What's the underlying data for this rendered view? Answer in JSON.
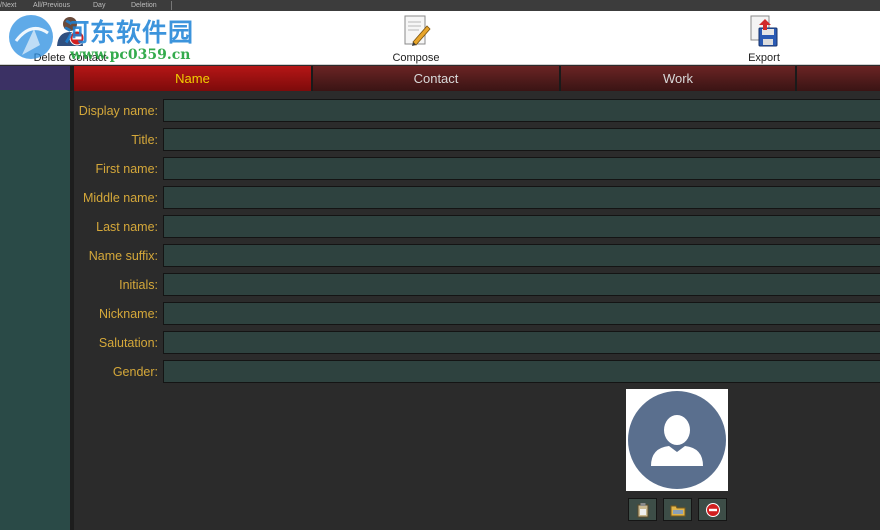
{
  "topbar": {
    "items": [
      "/Next",
      "All/Previous",
      "Day",
      "Deletion"
    ]
  },
  "toolbar": {
    "delete_contact_label": "Delete Contact",
    "compose_label": "Compose",
    "export_label": "Export"
  },
  "watermark": {
    "text": "河东软件园",
    "url": "www.pc0359.cn"
  },
  "tabs": [
    {
      "label": "Name",
      "active": true
    },
    {
      "label": "Contact",
      "active": false
    },
    {
      "label": "Work",
      "active": false
    },
    {
      "label": "",
      "active": false
    }
  ],
  "form": {
    "fields": [
      {
        "label": "Display name:",
        "value": ""
      },
      {
        "label": "Title:",
        "value": ""
      },
      {
        "label": "First name:",
        "value": ""
      },
      {
        "label": "Middle name:",
        "value": ""
      },
      {
        "label": "Last name:",
        "value": ""
      },
      {
        "label": "Name suffix:",
        "value": ""
      },
      {
        "label": "Initials:",
        "value": ""
      },
      {
        "label": "Nickname:",
        "value": ""
      },
      {
        "label": "Salutation:",
        "value": ""
      },
      {
        "label": "Gender:",
        "value": ""
      }
    ]
  },
  "colors": {
    "label": "#d5a83a",
    "active_tab_text": "#f2d000",
    "active_tab_bg": "#b51616",
    "field_bg": "#2e423f",
    "left_panel": "#2a4a47",
    "avatar": "#5a6f8e"
  },
  "icons": {
    "delete_contact": "person-remove-icon",
    "compose": "pencil-document-icon",
    "export": "floppy-export-icon",
    "photo_paste": "clipboard-icon",
    "photo_open": "folder-icon",
    "photo_remove": "remove-icon"
  }
}
